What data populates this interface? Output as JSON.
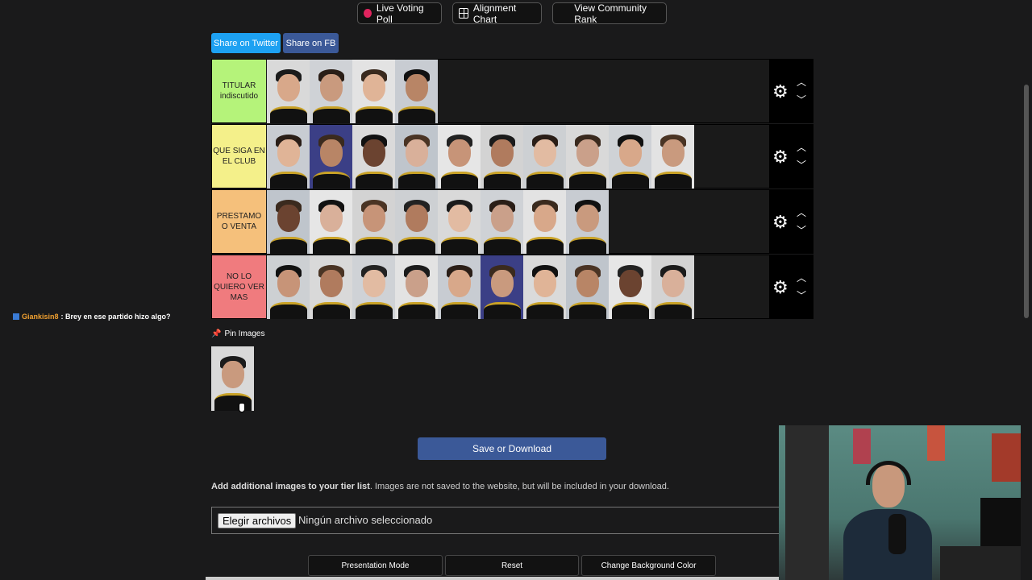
{
  "top_buttons": [
    {
      "label": "Live Voting Poll",
      "icon": "record-dot-icon"
    },
    {
      "label": "Alignment Chart",
      "icon": "grid-icon"
    },
    {
      "label": "View Community Rank",
      "icon": "rank-grid-icon"
    }
  ],
  "share": {
    "twitter": "Share on Twitter",
    "fb": "Share on FB"
  },
  "tiers": [
    {
      "label": "TITULAR indiscutido",
      "color": "#b5f37a",
      "count": 4
    },
    {
      "label": "QUE SIGA EN EL CLUB",
      "color": "#f4f08a",
      "count": 10
    },
    {
      "label": "PRESTAMO O VENTA",
      "color": "#f5c07b",
      "count": 8
    },
    {
      "label": "NO LO QUIERO VER MAS",
      "color": "#f07b7e",
      "count": 10
    }
  ],
  "pin": {
    "label": "Pin Images",
    "icon": "pin-icon"
  },
  "chat": {
    "user": "Giankisin8",
    "message": ": Brey en ese partido hizo algo?"
  },
  "save": "Save or Download",
  "add_images": {
    "bold": "Add additional images to your tier list",
    "rest": ". Images are not saved to the website, but will be included in your download."
  },
  "file_input": {
    "button": "Elegir archivos",
    "status": "Ningún archivo seleccionado"
  },
  "bottom_buttons": [
    "Presentation Mode",
    "Reset",
    "Change Background Color"
  ],
  "colors": {
    "twitter": "#1da1f2",
    "fb": "#3b5998",
    "save": "#3b5998"
  }
}
